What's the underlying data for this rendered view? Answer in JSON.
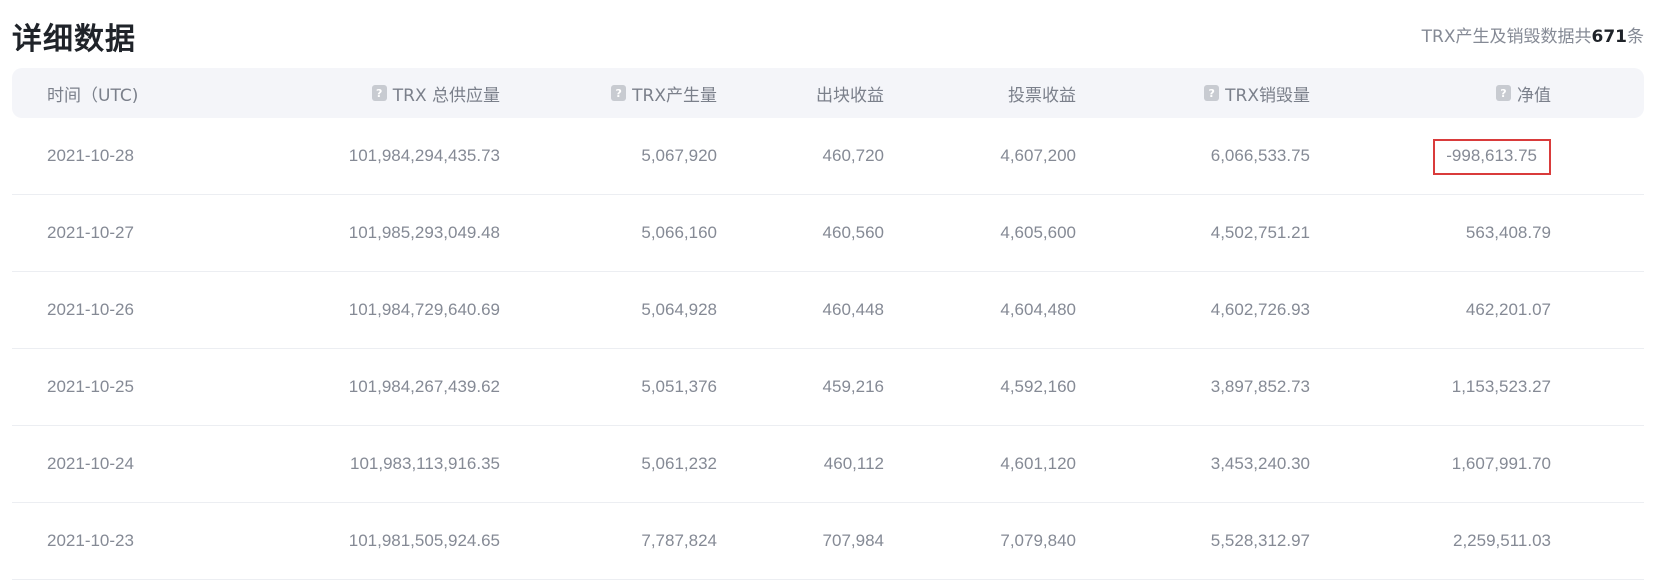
{
  "header": {
    "title": "详细数据",
    "summary_prefix": "TRX产生及销毁数据共",
    "summary_count": "671",
    "summary_suffix": "条"
  },
  "table": {
    "columns": {
      "date": "时间（UTC)",
      "supply": "TRX 总供应量",
      "production": "TRX产生量",
      "block_reward": "出块收益",
      "vote_reward": "投票收益",
      "burn": "TRX销毁量",
      "net": "净值"
    },
    "help_icon_glyph": "?",
    "rows": [
      {
        "date": "2021-10-28",
        "supply": "101,984,294,435.73",
        "production": "5,067,920",
        "block_reward": "460,720",
        "vote_reward": "4,607,200",
        "burn": "6,066,533.75",
        "net": "-998,613.75"
      },
      {
        "date": "2021-10-27",
        "supply": "101,985,293,049.48",
        "production": "5,066,160",
        "block_reward": "460,560",
        "vote_reward": "4,605,600",
        "burn": "4,502,751.21",
        "net": "563,408.79"
      },
      {
        "date": "2021-10-26",
        "supply": "101,984,729,640.69",
        "production": "5,064,928",
        "block_reward": "460,448",
        "vote_reward": "4,604,480",
        "burn": "4,602,726.93",
        "net": "462,201.07"
      },
      {
        "date": "2021-10-25",
        "supply": "101,984,267,439.62",
        "production": "5,051,376",
        "block_reward": "459,216",
        "vote_reward": "4,592,160",
        "burn": "3,897,852.73",
        "net": "1,153,523.27"
      },
      {
        "date": "2021-10-24",
        "supply": "101,983,113,916.35",
        "production": "5,061,232",
        "block_reward": "460,112",
        "vote_reward": "4,601,120",
        "burn": "3,453,240.30",
        "net": "1,607,991.70"
      },
      {
        "date": "2021-10-23",
        "supply": "101,981,505,924.65",
        "production": "7,787,824",
        "block_reward": "707,984",
        "vote_reward": "7,079,840",
        "burn": "5,528,312.97",
        "net": "2,259,511.03"
      }
    ]
  },
  "colors": {
    "highlight": "#d93b3b",
    "header_bg": "#f4f5f9"
  }
}
